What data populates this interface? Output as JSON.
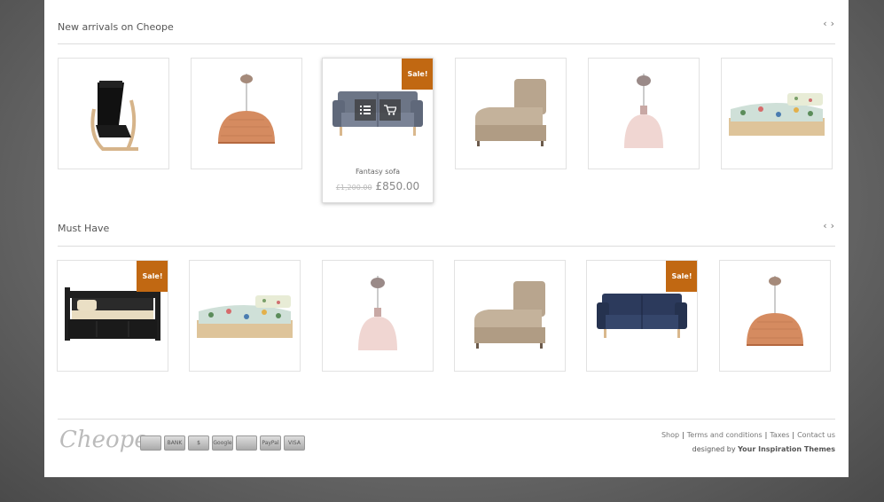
{
  "sections": [
    {
      "title": "New arrivals on Cheope",
      "prev": "‹",
      "next": "›",
      "products": [
        {
          "kind": "chair"
        },
        {
          "kind": "lamp-copper"
        },
        {
          "kind": "sofa-grey",
          "sale": "Sale!",
          "name": "Fantasy sofa",
          "old_price": "£1,200.00",
          "price": "£850.00",
          "hovered": true
        },
        {
          "kind": "chaise"
        },
        {
          "kind": "lamp-pink"
        },
        {
          "kind": "bed-floral"
        }
      ]
    },
    {
      "title": "Must Have",
      "prev": "‹",
      "next": "›",
      "products": [
        {
          "kind": "daybed",
          "sale": "Sale!"
        },
        {
          "kind": "bed-floral"
        },
        {
          "kind": "lamp-pink"
        },
        {
          "kind": "chaise"
        },
        {
          "kind": "sofa-navy",
          "sale": "Sale!"
        },
        {
          "kind": "lamp-copper"
        }
      ]
    }
  ],
  "footer": {
    "logo": "Cheope",
    "payment_icons": [
      "BANK",
      "$",
      "Google",
      "PayPal",
      "VISA"
    ],
    "links": [
      "Shop",
      "Terms and conditions",
      "Taxes",
      "Contact us"
    ],
    "credit_prefix": "designed by",
    "credit_name": "Your Inspiration Themes"
  },
  "colors": {
    "sale_badge": "#c16812",
    "page_bg": "#6a6a6a"
  }
}
